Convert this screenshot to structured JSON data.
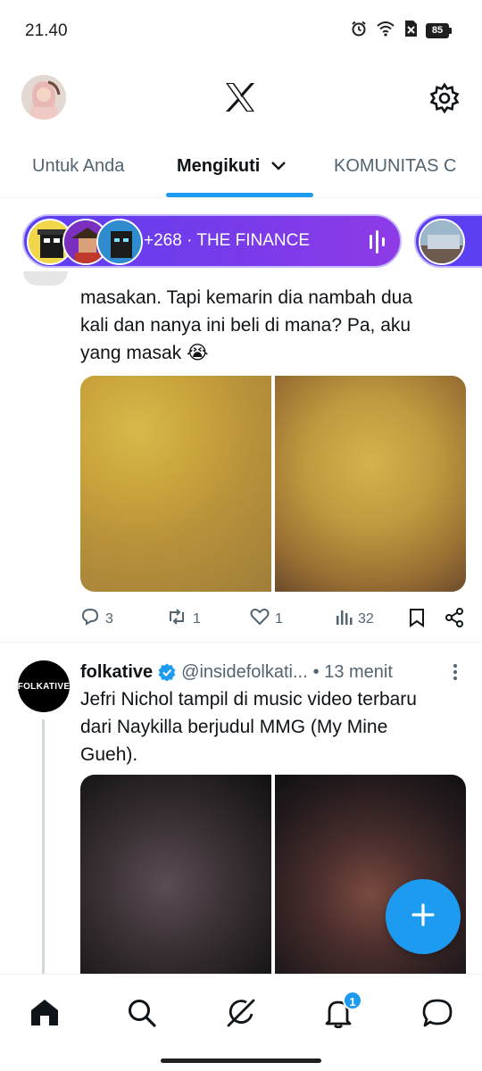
{
  "status_bar": {
    "time": "21.40",
    "battery": "85",
    "icons": [
      "alarm-icon",
      "wifi-icon",
      "sim-off-icon",
      "battery-icon"
    ]
  },
  "header": {
    "logo": "x-logo",
    "settings_icon": "gear-icon"
  },
  "tabs": [
    {
      "label": "Untuk Anda",
      "active": false
    },
    {
      "label": "Mengikuti",
      "active": true
    },
    {
      "label": "KOMUNITAS C",
      "active": false
    }
  ],
  "spaces": {
    "live_label": "+268 · THE FINANCE"
  },
  "tweets": [
    {
      "text": "masakan. Tapi kemarin dia nambah dua\nkali dan nanya ini beli di mana? Pa, aku\nyang masak 😭",
      "stats": {
        "replies": "3",
        "reposts": "1",
        "likes": "1",
        "views": "32"
      }
    },
    {
      "author": {
        "name": "folkative",
        "handle": "@insidefolkati...",
        "time": "• 13 menit",
        "avatar_text": "FOLKATIVE",
        "verified": true
      },
      "text": "Jefri Nichol tampil di music video terbaru\ndari Naykilla berjudul MMG (My Mine\nGueh)."
    }
  ],
  "bottom_nav": {
    "items": [
      "home-icon",
      "search-icon",
      "grok-icon",
      "notifications-icon",
      "messages-icon"
    ],
    "notification_badge": "1"
  },
  "colors": {
    "accent": "#1d9bf0",
    "space_purple": "#5b3ff0",
    "text_primary": "#0f1419",
    "text_secondary": "#536471"
  }
}
